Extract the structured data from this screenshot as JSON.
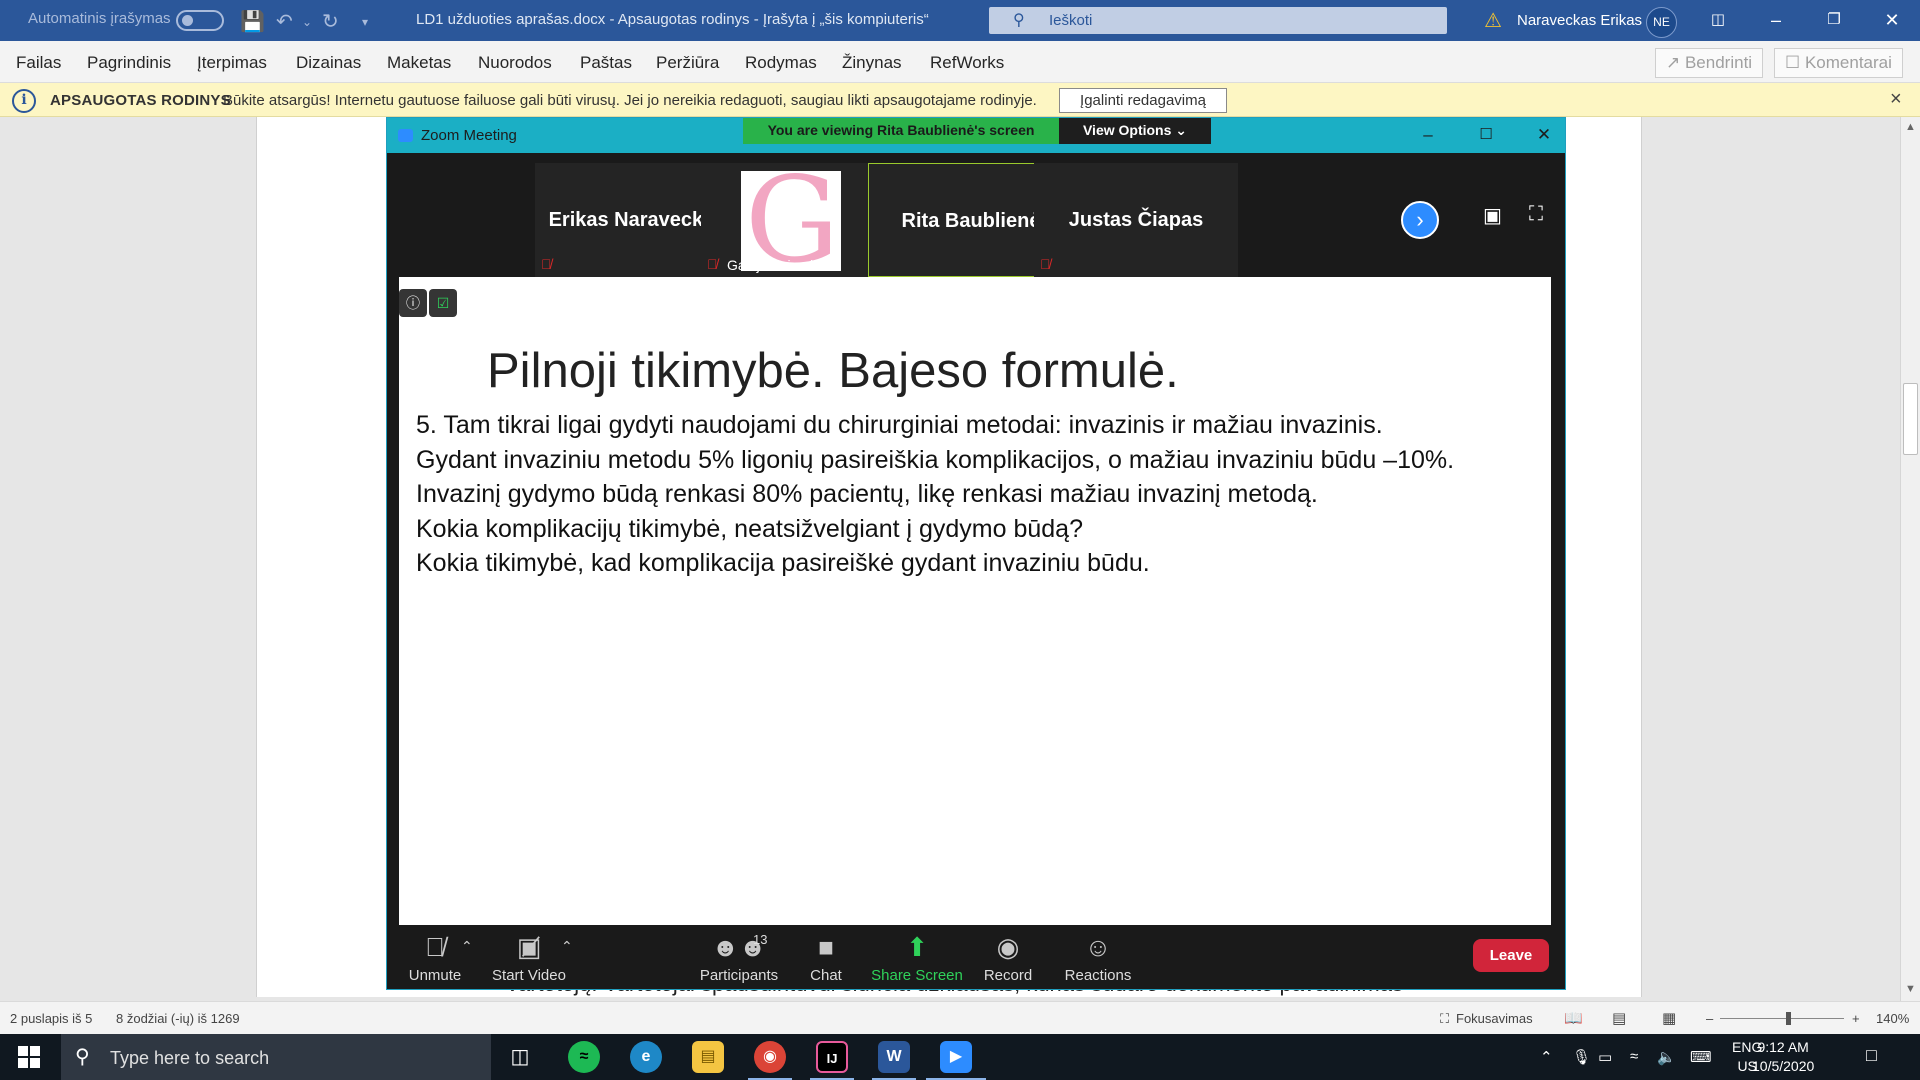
{
  "word": {
    "autosave_label": "Automatinis įrašymas",
    "doc_title": "LD1 užduoties aprašas.docx  -  Apsaugotas rodinys  -  Įrašyta į „šis kompiuteris“",
    "search_placeholder": "Ieškoti",
    "user_name": "Naraveckas Erikas",
    "user_initials": "NE",
    "ribbon_tabs": [
      "Failas",
      "Pagrindinis",
      "Įterpimas",
      "Dizainas",
      "Maketas",
      "Nuorodos",
      "Paštas",
      "Peržiūra",
      "Rodymas",
      "Žinynas",
      "RefWorks"
    ],
    "share_label": "Bendrinti",
    "comments_label": "Komentarai",
    "banner": {
      "title": "APSAUGOTAS RODINYS",
      "message": "Būkite atsargūs! Internetu gautuose failuose gali būti virusų. Jei jo nereikia redaguoti, saugiau likti apsaugotajame rodinyje.",
      "button": "Įgalinti redagavimą"
    },
    "page_peek_text": "vartotojų. Vartotojai spausdintuvui siunčia užklausas, kurias sudaro dokumento pavadinimas",
    "status": {
      "page": "2 puslapis iš 5",
      "words": "8 žodžiai (-ių) iš 1269",
      "focus": "Fokusavimas",
      "zoom": "140%"
    }
  },
  "zoom": {
    "window_title": "Zoom Meeting",
    "viewing_banner": "You are viewing Rita Baublienė's screen",
    "view_options": "View Options",
    "participants": [
      {
        "name": "Erikas Naraveckas",
        "muted": true
      },
      {
        "name": "Gabija Vaivad...",
        "muted": true,
        "has_picture": true
      },
      {
        "name": "Rita Baublienė",
        "muted": false,
        "active": true
      },
      {
        "name": "Justas Čiapas",
        "muted": true
      }
    ],
    "slide": {
      "title": "Pilnoji tikimybė. Bajeso formulė.",
      "lines": [
        "5. Tam tikrai ligai gydyti naudojami du chirurginiai metodai: invazinis ir mažiau invazinis.",
        "Gydant invaziniu metodu 5% ligonių pasireiškia komplikacijos, o mažiau invaziniu būdu –10%.",
        "Invazinį gydymo būdą renkasi 80% pacientų, likę renkasi mažiau invazinį metodą.",
        "Kokia komplikacijų tikimybė, neatsižvelgiant į gydymo būdą?",
        "Kokia tikimybė, kad komplikacija pasireiškė gydant invaziniu būdu."
      ]
    },
    "controls": {
      "unmute": "Unmute",
      "start_video": "Start Video",
      "participants": "Participants",
      "participants_count": "13",
      "chat": "Chat",
      "share_screen": "Share Screen",
      "record": "Record",
      "reactions": "Reactions",
      "leave": "Leave"
    }
  },
  "taskbar": {
    "search_placeholder": "Type here to search",
    "lang_top": "ENG",
    "lang_bottom": "US",
    "time": "9:12 AM",
    "date": "10/5/2020"
  },
  "colors": {
    "word_blue": "#2b579a",
    "zoom_teal": "#1bafc5",
    "zoom_green": "#29b24a",
    "leave_red": "#d1253a",
    "banner_yellow": "#fdf6c3"
  }
}
